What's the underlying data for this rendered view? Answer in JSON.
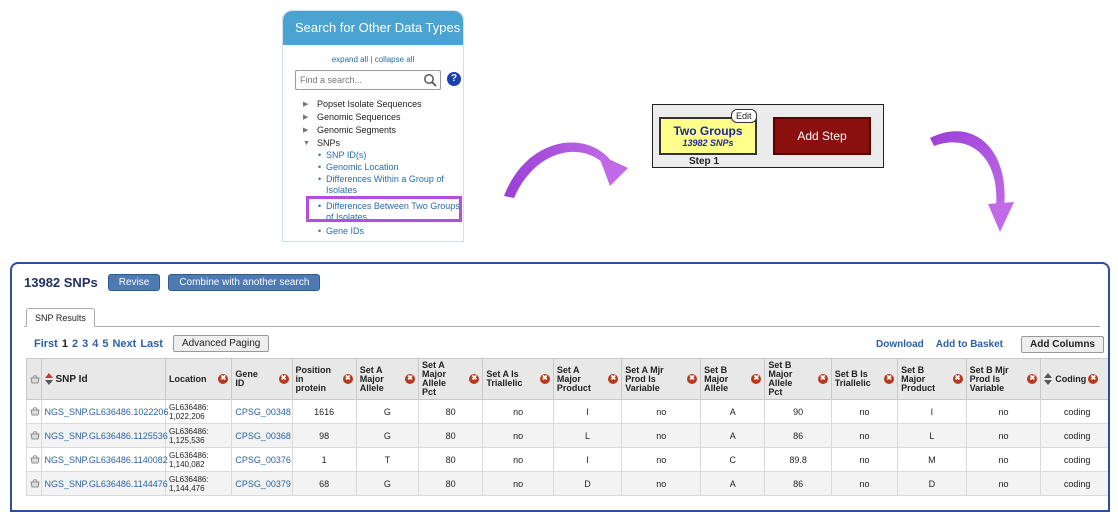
{
  "search_panel": {
    "title": "Search for Other Data Types",
    "expand_all": "expand all",
    "separator": "|",
    "collapse_all": "collapse all",
    "placeholder": "Find a search...",
    "help": "?",
    "tree": [
      {
        "label": "Popset Isolate Sequences"
      },
      {
        "label": "Genomic Sequences"
      },
      {
        "label": "Genomic Segments"
      },
      {
        "label": "SNPs"
      }
    ],
    "snp_children": [
      "SNP ID(s)",
      "Genomic Location",
      "Differences Within a Group of Isolates",
      "Differences Between Two Groups of Isolates",
      "Gene IDs"
    ]
  },
  "strategy": {
    "step_title": "Two Groups",
    "step_count": "13982 SNPs",
    "edit": "Edit",
    "step_label": "Step 1",
    "add_step": "Add Step"
  },
  "results": {
    "count": "13982 SNPs",
    "revise": "Revise",
    "combine": "Combine with another search",
    "tab": "SNP Results",
    "pager": {
      "first": "First",
      "pages": [
        "1",
        "2",
        "3",
        "4",
        "5"
      ],
      "next": "Next",
      "last": "Last",
      "advanced": "Advanced Paging"
    },
    "download": "Download",
    "add_to_basket": "Add to Basket",
    "add_columns": "Add Columns",
    "columns": [
      "SNP Id",
      "Location",
      "Gene ID",
      "Position in protein",
      "Set A Major Allele",
      "Set A Major Allele Pct",
      "Set A Is Triallelic",
      "Set A Major Product",
      "Set A Mjr Prod Is Variable",
      "Set B Major Allele",
      "Set B Major Allele Pct",
      "Set B Is Triallelic",
      "Set B Major Product",
      "Set B Mjr Prod Is Variable",
      "Coding"
    ],
    "rows": [
      {
        "snp": "NGS_SNP.GL636486.1022206",
        "loc1": "GL636486:",
        "loc2": "1,022,206",
        "gene": "CPSG_00348",
        "pos": "1616",
        "a_allele": "G",
        "a_pct": "80",
        "a_tri": "no",
        "a_prod": "I",
        "a_var": "no",
        "b_allele": "A",
        "b_pct": "90",
        "b_tri": "no",
        "b_prod": "I",
        "b_var": "no",
        "coding": "coding"
      },
      {
        "snp": "NGS_SNP.GL636486.1125536",
        "loc1": "GL636486:",
        "loc2": "1,125,536",
        "gene": "CPSG_00368",
        "pos": "98",
        "a_allele": "G",
        "a_pct": "80",
        "a_tri": "no",
        "a_prod": "L",
        "a_var": "no",
        "b_allele": "A",
        "b_pct": "86",
        "b_tri": "no",
        "b_prod": "L",
        "b_var": "no",
        "coding": "coding"
      },
      {
        "snp": "NGS_SNP.GL636486.1140082",
        "loc1": "GL636486:",
        "loc2": "1,140,082",
        "gene": "CPSG_00376",
        "pos": "1",
        "a_allele": "T",
        "a_pct": "80",
        "a_tri": "no",
        "a_prod": "I",
        "a_var": "no",
        "b_allele": "C",
        "b_pct": "89.8",
        "b_tri": "no",
        "b_prod": "M",
        "b_var": "no",
        "coding": "coding"
      },
      {
        "snp": "NGS_SNP.GL636486.1144476",
        "loc1": "GL636486:",
        "loc2": "1,144,476",
        "gene": "CPSG_00379",
        "pos": "68",
        "a_allele": "G",
        "a_pct": "80",
        "a_tri": "no",
        "a_prod": "D",
        "a_var": "no",
        "b_allele": "A",
        "b_pct": "86",
        "b_tri": "no",
        "b_prod": "D",
        "b_var": "no",
        "coding": "coding"
      }
    ]
  },
  "colors": {
    "accent": "#4aa3d0",
    "highlight": "#b34fe0",
    "step": "#ffff8a",
    "add_step": "#8a1010",
    "arrow": "#b34fe0"
  }
}
